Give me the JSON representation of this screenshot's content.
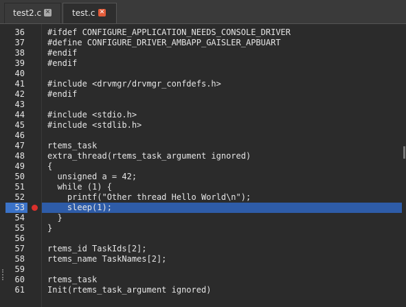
{
  "tabs": [
    {
      "label": "test2.c",
      "close": "✕",
      "active": false
    },
    {
      "label": "test.c",
      "close": "✕",
      "active": true
    }
  ],
  "editor": {
    "breakpoint_line": "53",
    "current_line": "53",
    "lines": [
      {
        "num": "36",
        "code": "#ifdef CONFIGURE_APPLICATION_NEEDS_CONSOLE_DRIVER"
      },
      {
        "num": "37",
        "code": "#define CONFIGURE_DRIVER_AMBAPP_GAISLER_APBUART"
      },
      {
        "num": "38",
        "code": "#endif"
      },
      {
        "num": "39",
        "code": "#endif"
      },
      {
        "num": "40",
        "code": ""
      },
      {
        "num": "41",
        "code": "#include <drvmgr/drvmgr_confdefs.h>"
      },
      {
        "num": "42",
        "code": "#endif"
      },
      {
        "num": "43",
        "code": ""
      },
      {
        "num": "44",
        "code": "#include <stdio.h>"
      },
      {
        "num": "45",
        "code": "#include <stdlib.h>"
      },
      {
        "num": "46",
        "code": ""
      },
      {
        "num": "47",
        "code": "rtems_task"
      },
      {
        "num": "48",
        "code": "extra_thread(rtems_task_argument ignored)"
      },
      {
        "num": "49",
        "code": "{"
      },
      {
        "num": "50",
        "code": "  unsigned a = 42;"
      },
      {
        "num": "51",
        "code": "  while (1) {"
      },
      {
        "num": "52",
        "code": "    printf(\"Other thread Hello World\\n\");"
      },
      {
        "num": "53",
        "code": "    sleep(1);"
      },
      {
        "num": "54",
        "code": "  }"
      },
      {
        "num": "55",
        "code": "}"
      },
      {
        "num": "56",
        "code": ""
      },
      {
        "num": "57",
        "code": "rtems_id TaskIds[2];"
      },
      {
        "num": "58",
        "code": "rtems_name TaskNames[2];"
      },
      {
        "num": "59",
        "code": ""
      },
      {
        "num": "60",
        "code": "rtems_task"
      },
      {
        "num": "61",
        "code": "Init(rtems_task_argument ignored)"
      }
    ]
  }
}
